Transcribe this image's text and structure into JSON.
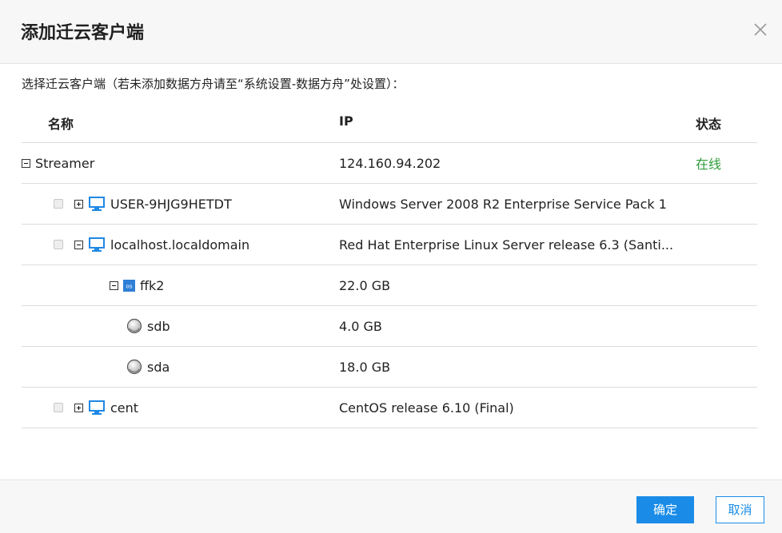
{
  "dialog": {
    "title": "添加迁云客户端",
    "instruction": "选择迁云客户端（若未添加数据方舟请至“系统设置-数据方舟”处设置）：",
    "ok_label": "确定",
    "cancel_label": "取消"
  },
  "table": {
    "headers": {
      "name": "名称",
      "ip": "IP",
      "status": "状态"
    },
    "rows": [
      {
        "name": "Streamer",
        "info": "124.160.94.202",
        "status": "在线",
        "status_color": "#2e9c3a"
      },
      {
        "name": "USER-9HJG9HETDT",
        "info": "Windows Server 2008 R2 Enterprise Service Pack 1",
        "status": ""
      },
      {
        "name": "localhost.localdomain",
        "info": "Red Hat Enterprise Linux Server release 6.3 (Santi...",
        "status": ""
      },
      {
        "name": "ffk2",
        "info": "22.0 GB",
        "status": ""
      },
      {
        "name": "sdb",
        "info": "4.0 GB",
        "status": ""
      },
      {
        "name": "sda",
        "info": "18.0 GB",
        "status": ""
      },
      {
        "name": "cent",
        "info": "CentOS release 6.10 (Final)",
        "status": ""
      }
    ]
  },
  "icons": {
    "close": "close-icon",
    "computer": "monitor-icon",
    "os": "os-icon",
    "disk": "disk-icon",
    "expand": "plus-box-icon",
    "collapse": "minus-box-icon"
  },
  "colors": {
    "accent": "#1a8ce8",
    "online": "#2e9c3a",
    "header_bg": "#f7f7f7"
  }
}
